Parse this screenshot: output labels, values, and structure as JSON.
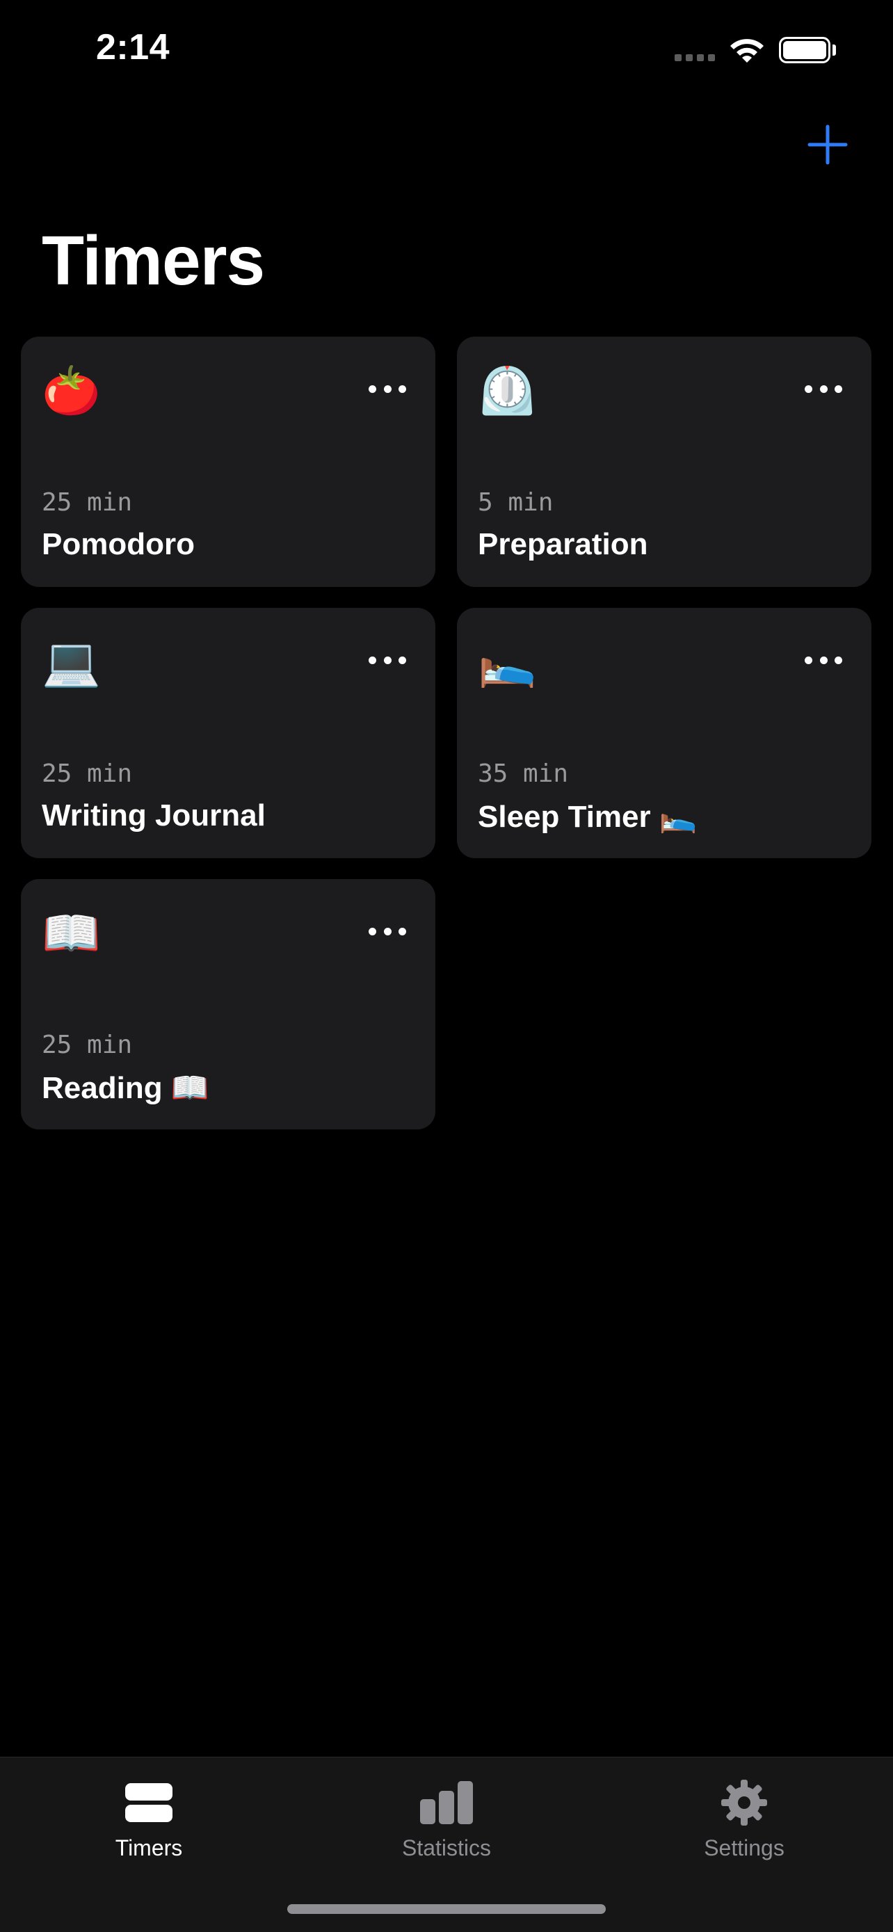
{
  "status_bar": {
    "time": "2:14"
  },
  "header": {
    "title": "Timers"
  },
  "timers": [
    {
      "emoji": "🍅",
      "duration": "25 min",
      "title": "Pomodoro"
    },
    {
      "emoji": "⏲️",
      "duration": "5 min",
      "title": "Preparation"
    },
    {
      "emoji": "💻",
      "duration": "25 min",
      "title": "Writing Journal"
    },
    {
      "emoji": "🛌",
      "duration": "35 min",
      "title": "Sleep Timer 🛌"
    },
    {
      "emoji": "📖",
      "duration": "25 min",
      "title": "Reading 📖"
    }
  ],
  "tab_bar": {
    "tabs": [
      {
        "label": "Timers",
        "icon": "timers-icon",
        "selected": true
      },
      {
        "label": "Statistics",
        "icon": "chart-bar-icon",
        "selected": false
      },
      {
        "label": "Settings",
        "icon": "gear-icon",
        "selected": false
      }
    ]
  },
  "colors": {
    "accent": "#2f7cf6",
    "card_background": "#1c1c1e",
    "tab_active": "#ffffff",
    "tab_inactive": "#8e8e93"
  }
}
